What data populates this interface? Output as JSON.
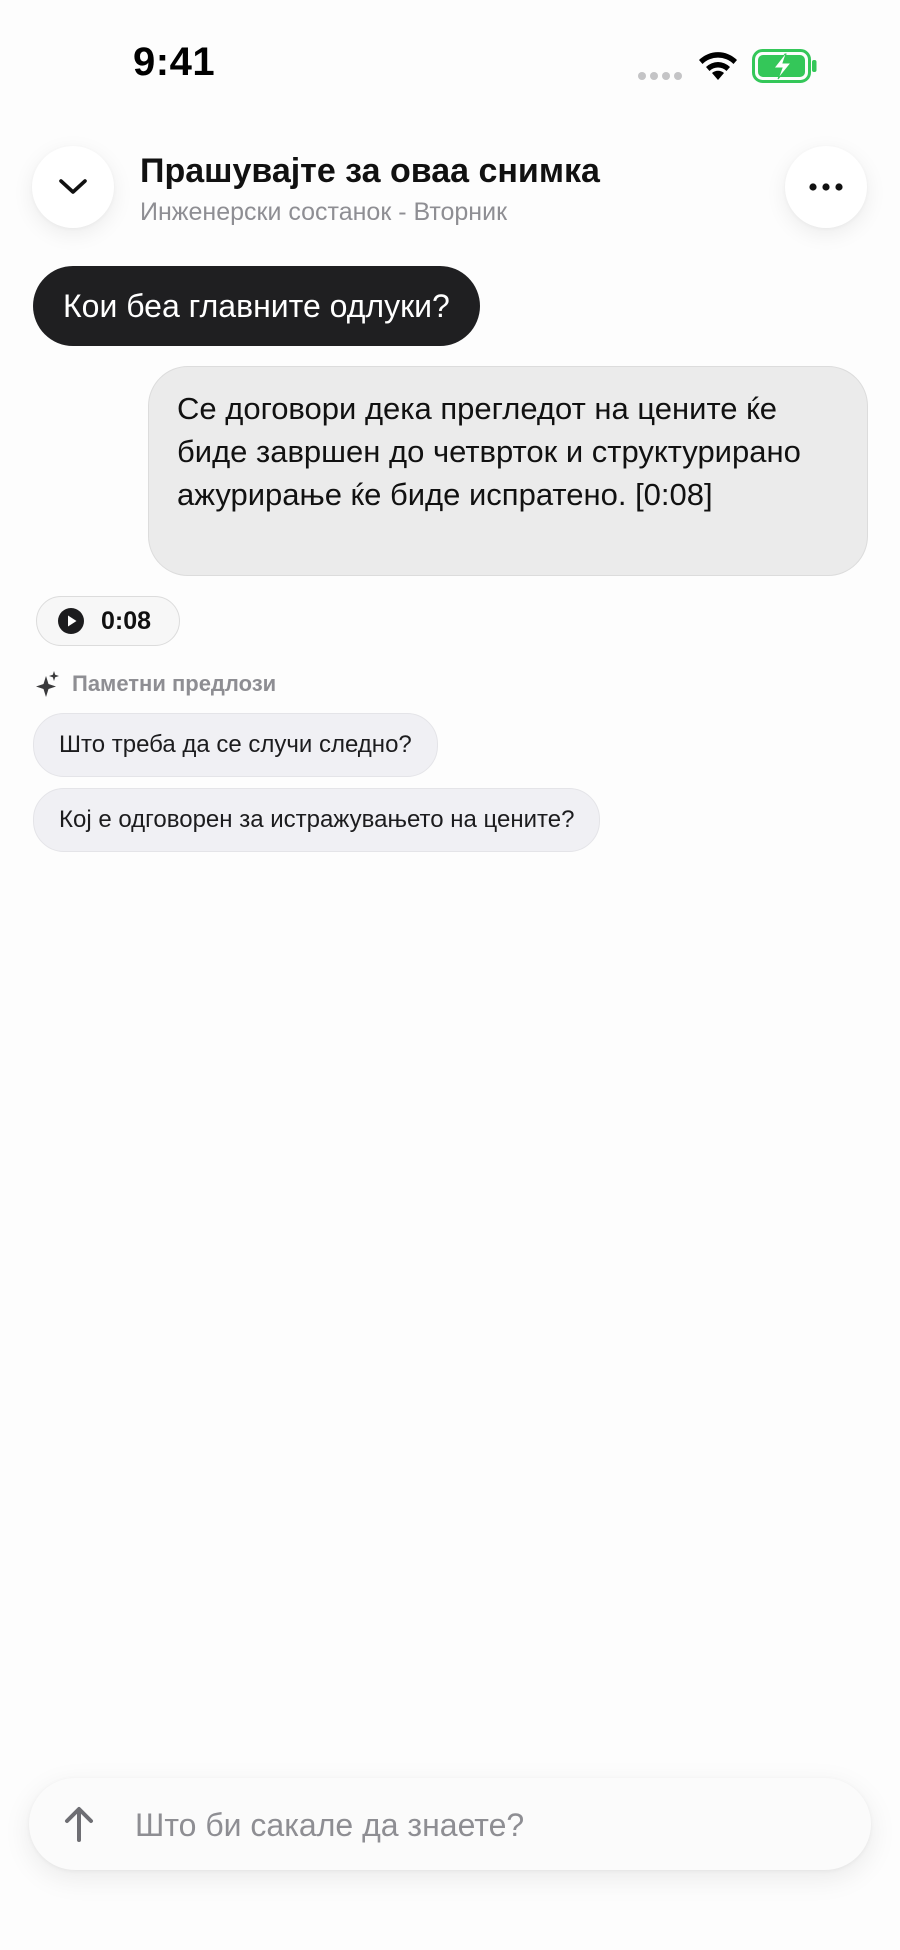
{
  "status_bar": {
    "time": "9:41",
    "battery_color": "#34c759"
  },
  "header": {
    "back_icon": "chevron-down-icon",
    "title": "Прашувајте за оваа снимка",
    "subtitle": "Инженерски состанок - Вторник",
    "more_icon": "ellipsis-icon"
  },
  "conversation": {
    "user_question": "Кои беа главните одлуки?",
    "answer": "Се договори дека прегледот на цените ќе биде завршен до четврток и структурирано ажурирање ќе биде испратено. [0:08]",
    "playback_timestamp": "0:08"
  },
  "suggestions": {
    "label": "Паметни предлози",
    "icon": "sparkle-icon",
    "items": [
      "Што треба да се случи следно?",
      "Кој е одговорен за истражувањето на цените?"
    ]
  },
  "input": {
    "placeholder": "Што би сакале да знаете?",
    "value": "",
    "send_icon": "arrow-up-icon"
  }
}
